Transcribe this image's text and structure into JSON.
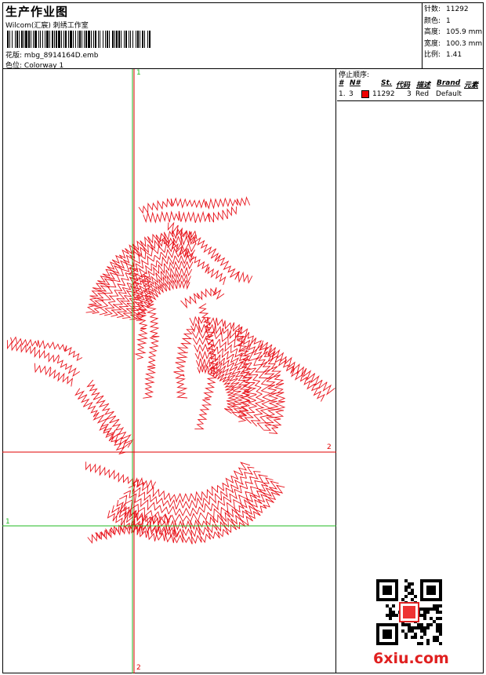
{
  "header": {
    "title": "生产作业图",
    "studio": "Wilcom(汇宸) 刺绣工作室",
    "design_label": "花版:",
    "design_file": "mbg_8914164D.emb",
    "colorway_label": "色位:",
    "colorway": "Colorway 1"
  },
  "stats": [
    {
      "label": "针数:",
      "value": "11292"
    },
    {
      "label": "颜色:",
      "value": "1"
    },
    {
      "label": "高度:",
      "value": "105.9 mm"
    },
    {
      "label": "宽度:",
      "value": "100.3 mm"
    },
    {
      "label": "比例:",
      "value": "1.41"
    }
  ],
  "stop_sequence": {
    "title": "停止顺序:",
    "columns": [
      "#",
      "N#",
      "St.",
      "代码",
      "描述",
      "Brand",
      "元素"
    ],
    "rows": [
      {
        "index": "1.",
        "needle": "3",
        "stitches": "11292",
        "code": "3",
        "description": "Red",
        "brand": "Default",
        "color": "#e00000"
      }
    ]
  },
  "guides": {
    "v_top": "1",
    "v_bottom": "2",
    "h_red": "2",
    "h_green": "1"
  },
  "watermark": "6xiu.com",
  "colors": {
    "stitch": "#e8141c",
    "guide_red": "#e00000",
    "guide_green": "#22b822"
  }
}
